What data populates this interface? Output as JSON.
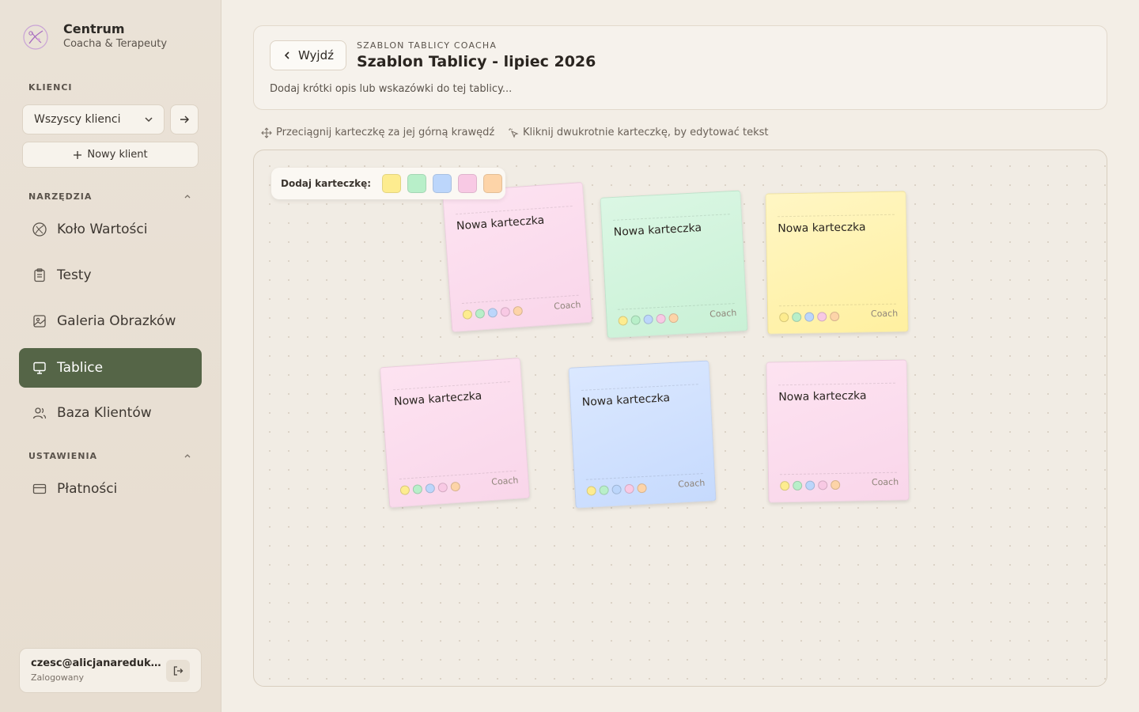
{
  "brand": {
    "name": "Centrum",
    "subtitle": "Coacha & Terapeuty"
  },
  "sidebar": {
    "clients_label": "KLIENCI",
    "client_select": "Wszyscy klienci",
    "new_client": "Nowy klient",
    "tools_label": "NARZĘDZIA",
    "settings_label": "USTAWIENIA",
    "items": [
      {
        "label": "Koło Wartości",
        "icon": "value-wheel-icon"
      },
      {
        "label": "Testy",
        "icon": "clipboard-icon"
      },
      {
        "label": "Galeria Obrazków",
        "icon": "image-icon"
      },
      {
        "label": "Tablice",
        "icon": "presentation-icon"
      },
      {
        "label": "Baza Klientów",
        "icon": "users-icon"
      },
      {
        "label": "Płatności",
        "icon": "credit-card-icon"
      }
    ],
    "user_email": "czesc@alicjanaredukcji...",
    "user_status": "Zalogowany"
  },
  "header": {
    "back_label": "Wyjdź",
    "kicker": "SZABLON TABLICY COACHA",
    "title": "Szablon Tablicy - lipiec 2026",
    "description": "Dodaj krótki opis lub wskazówki do tej tablicy..."
  },
  "hints": {
    "drag": "Przeciągnij karteczkę za jej górną krawędź",
    "edit": "Kliknij dwukrotnie karteczkę, by edytować tekst"
  },
  "board": {
    "add_label": "Dodaj karteczkę:",
    "swatch_colors": [
      "#fdec8f",
      "#b8efc9",
      "#bcd6fb",
      "#f8c9e4",
      "#fdd4a8"
    ],
    "notes": [
      {
        "text": "Nowa karteczka",
        "author": "Coach",
        "color": "pink"
      },
      {
        "text": "Nowa karteczka",
        "author": "Coach",
        "color": "green"
      },
      {
        "text": "Nowa karteczka",
        "author": "Coach",
        "color": "yellow"
      },
      {
        "text": "Nowa karteczka",
        "author": "Coach",
        "color": "pink"
      },
      {
        "text": "Nowa karteczka",
        "author": "Coach",
        "color": "blue"
      },
      {
        "text": "Nowa karteczka",
        "author": "Coach",
        "color": "pink"
      }
    ]
  }
}
